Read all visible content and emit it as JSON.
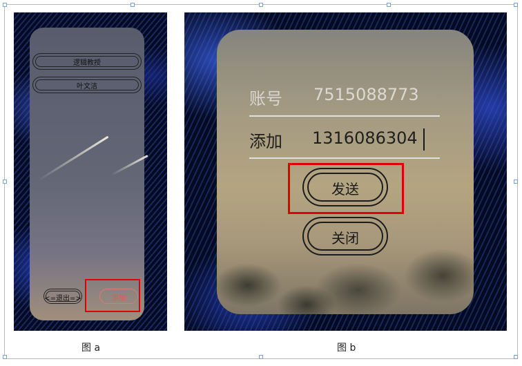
{
  "figure_a": {
    "caption": "图 a",
    "contacts": [
      "逻辑教授",
      "叶文洁"
    ],
    "exit_label": "<=退出=>",
    "add_label": "添加"
  },
  "figure_b": {
    "caption": "图 b",
    "account_label": "账号",
    "account_value": "7515088773",
    "add_label": "添加",
    "add_value": "1316086304",
    "send_label": "发送",
    "close_label": "关闭"
  },
  "colors": {
    "highlight": "#e00000",
    "page_background": "#ffffff"
  }
}
